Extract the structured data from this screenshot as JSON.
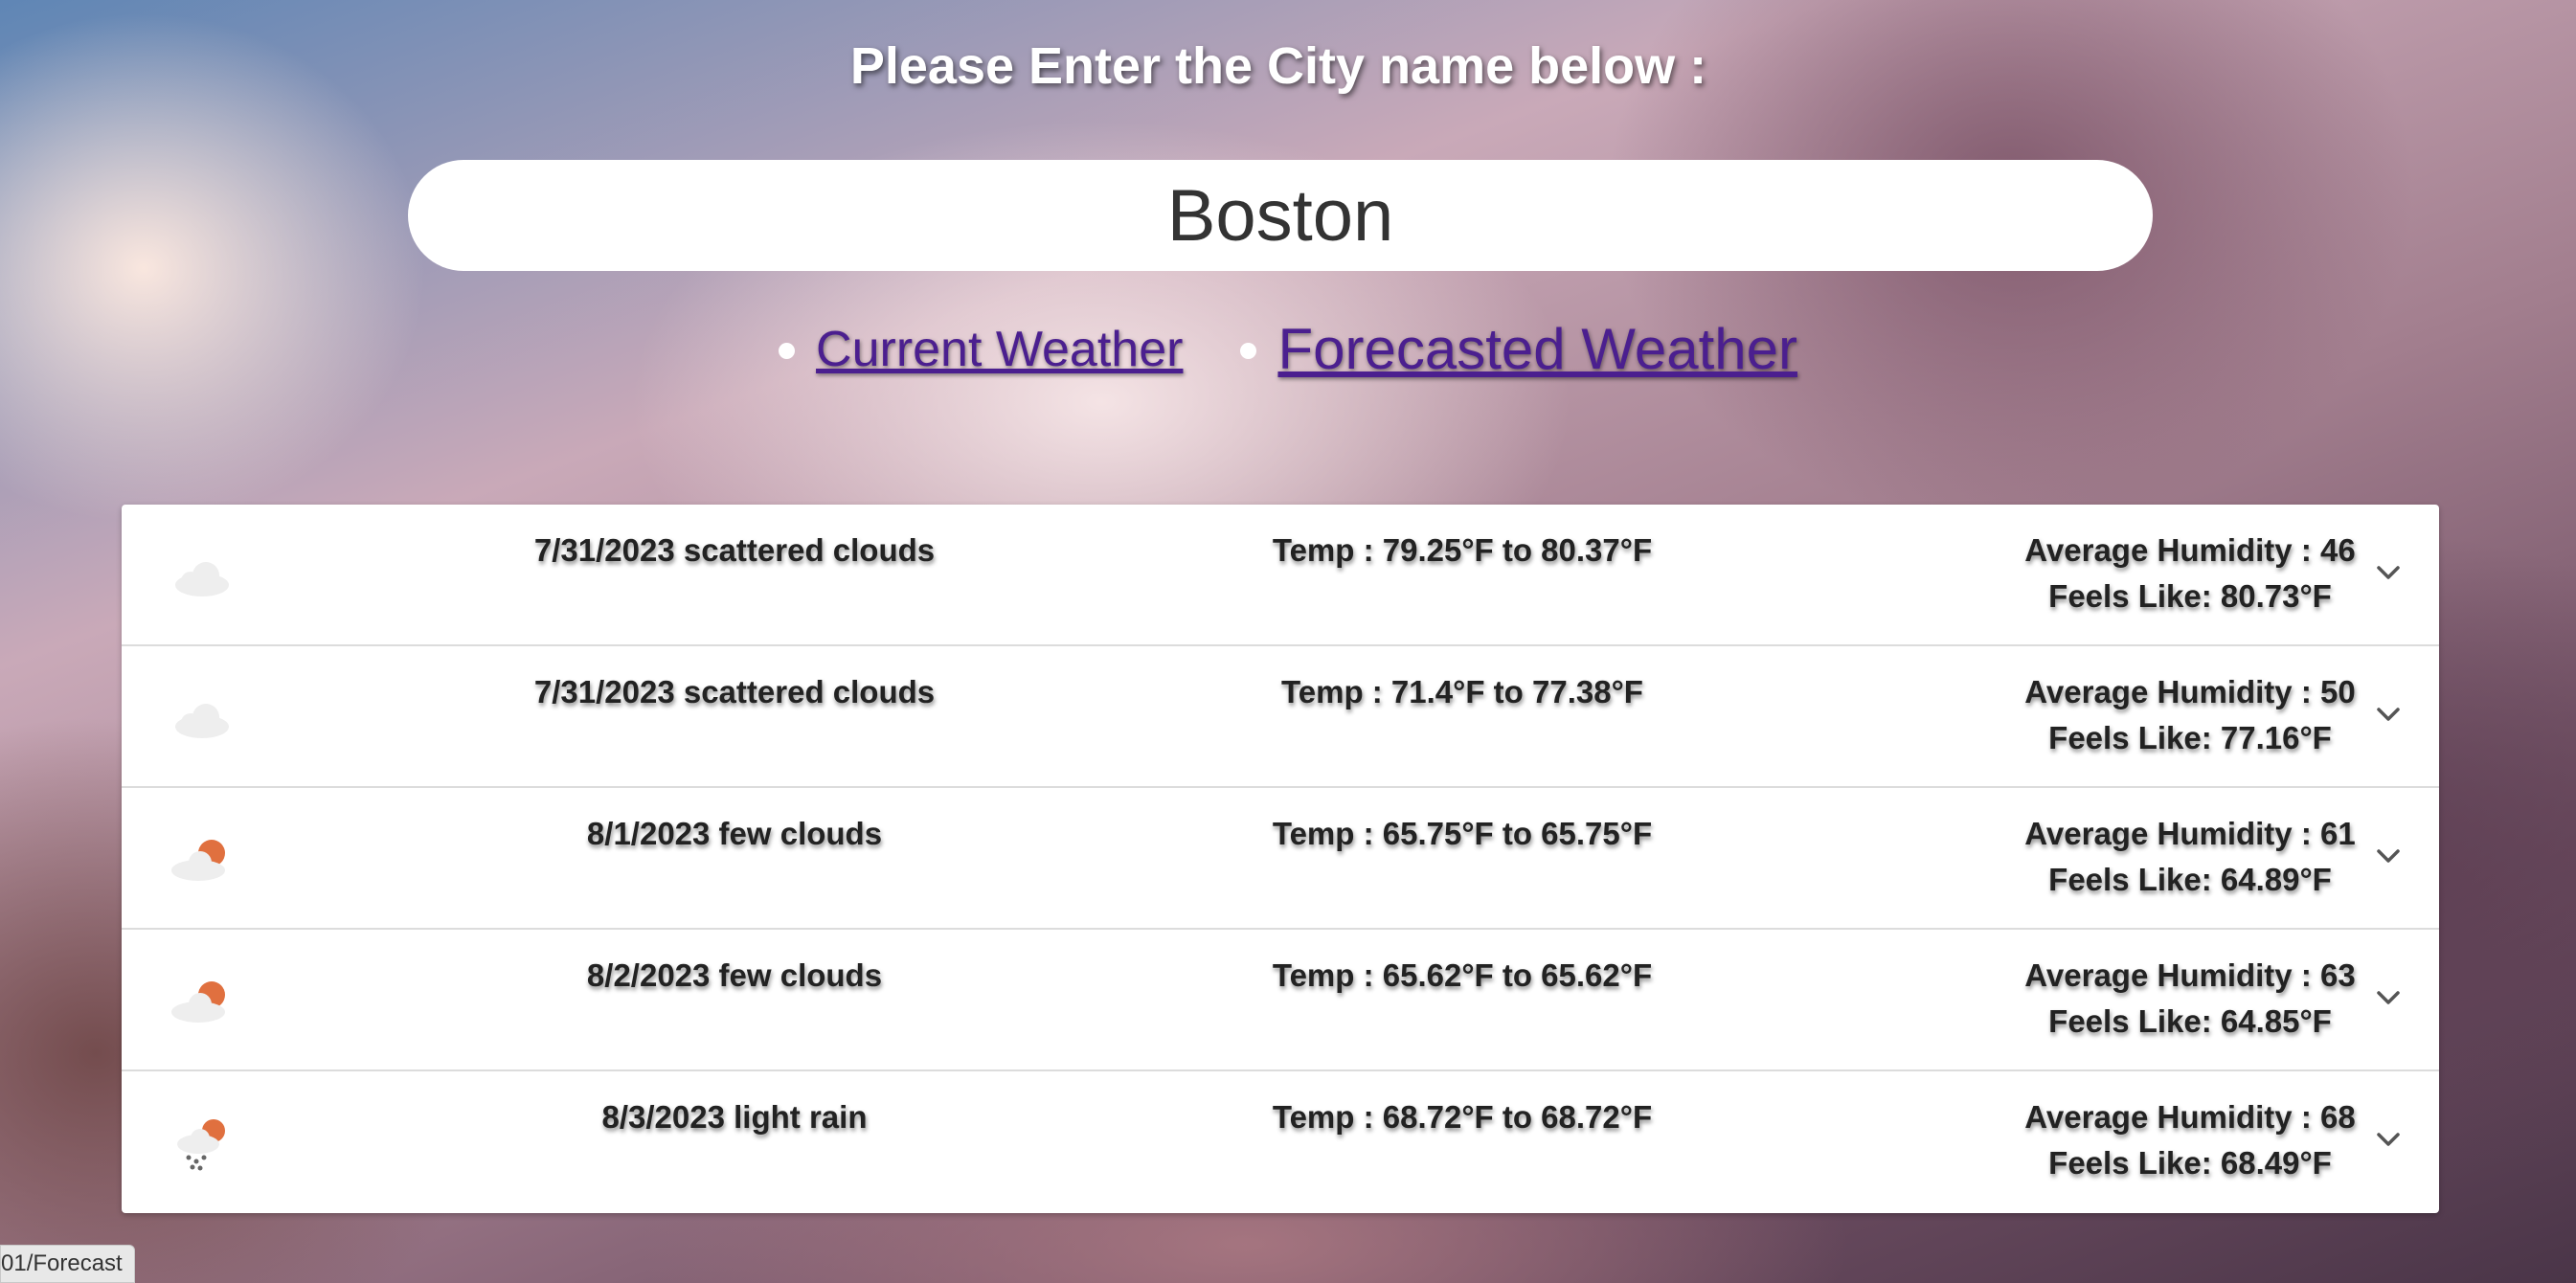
{
  "heading": "Please Enter the City name below :",
  "search": {
    "value": "Boston"
  },
  "nav": {
    "current_weather": "Current Weather",
    "forecasted_weather": "Forecasted Weather"
  },
  "forecast": [
    {
      "icon": "cloud-icon",
      "date_desc": "7/31/2023 scattered clouds",
      "temp": "Temp : 79.25°F to 80.37°F",
      "humidity": "Average Humidity : 46",
      "feels_like": "Feels Like: 80.73°F"
    },
    {
      "icon": "cloud-icon",
      "date_desc": "7/31/2023 scattered clouds",
      "temp": "Temp : 71.4°F to 77.38°F",
      "humidity": "Average Humidity : 50",
      "feels_like": "Feels Like: 77.16°F"
    },
    {
      "icon": "sun-behind-cloud-icon",
      "date_desc": "8/1/2023 few clouds",
      "temp": "Temp : 65.75°F to 65.75°F",
      "humidity": "Average Humidity : 61",
      "feels_like": "Feels Like: 64.89°F"
    },
    {
      "icon": "sun-behind-cloud-icon",
      "date_desc": "8/2/2023 few clouds",
      "temp": "Temp : 65.62°F to 65.62°F",
      "humidity": "Average Humidity : 63",
      "feels_like": "Feels Like: 64.85°F"
    },
    {
      "icon": "rain-cloud-sun-icon",
      "date_desc": "8/3/2023 light rain",
      "temp": "Temp : 68.72°F to 68.72°F",
      "humidity": "Average Humidity : 68",
      "feels_like": "Feels Like: 68.49°F"
    }
  ],
  "status_bar": {
    "text": "01/Forecast"
  },
  "colors": {
    "link": "#4b1f8f",
    "sun": "#e0703f",
    "cloud": "#eeeeee"
  }
}
